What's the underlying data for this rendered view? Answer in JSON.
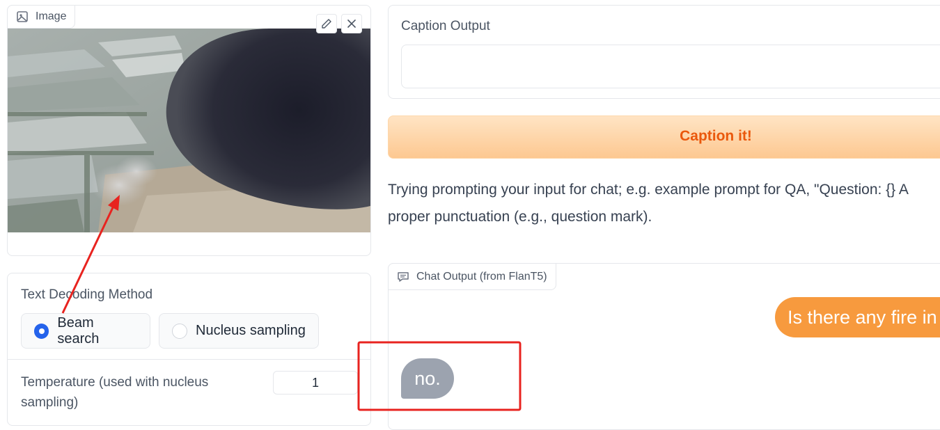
{
  "image_panel": {
    "label": "Image",
    "label_icon": "image-icon",
    "edit_icon": "pencil-icon",
    "clear_icon": "close-icon"
  },
  "decoding": {
    "label": "Text Decoding Method",
    "options": [
      "Beam search",
      "Nucleus sampling"
    ],
    "selected": "Beam search",
    "accent": "#2563eb"
  },
  "temperature": {
    "label": "Temperature (used with nucleus sampling)",
    "value": "1"
  },
  "caption_output": {
    "label": "Caption Output",
    "value": ""
  },
  "caption_button": {
    "label": "Caption it!",
    "text_color": "#ea580c"
  },
  "prompt_tip": {
    "text": "Trying prompting your input for chat; e.g. example prompt for QA, \"Question: {} A proper punctuation (e.g., question mark)."
  },
  "chat": {
    "label": "Chat Output (from FlanT5)",
    "label_icon": "chat-icon",
    "messages": [
      {
        "role": "user",
        "text": "Is there any fire in",
        "color": "#f79a3e"
      },
      {
        "role": "bot",
        "text": "no.",
        "color": "#9ca3af"
      }
    ]
  },
  "annotations": {
    "color": "#e8231f"
  }
}
